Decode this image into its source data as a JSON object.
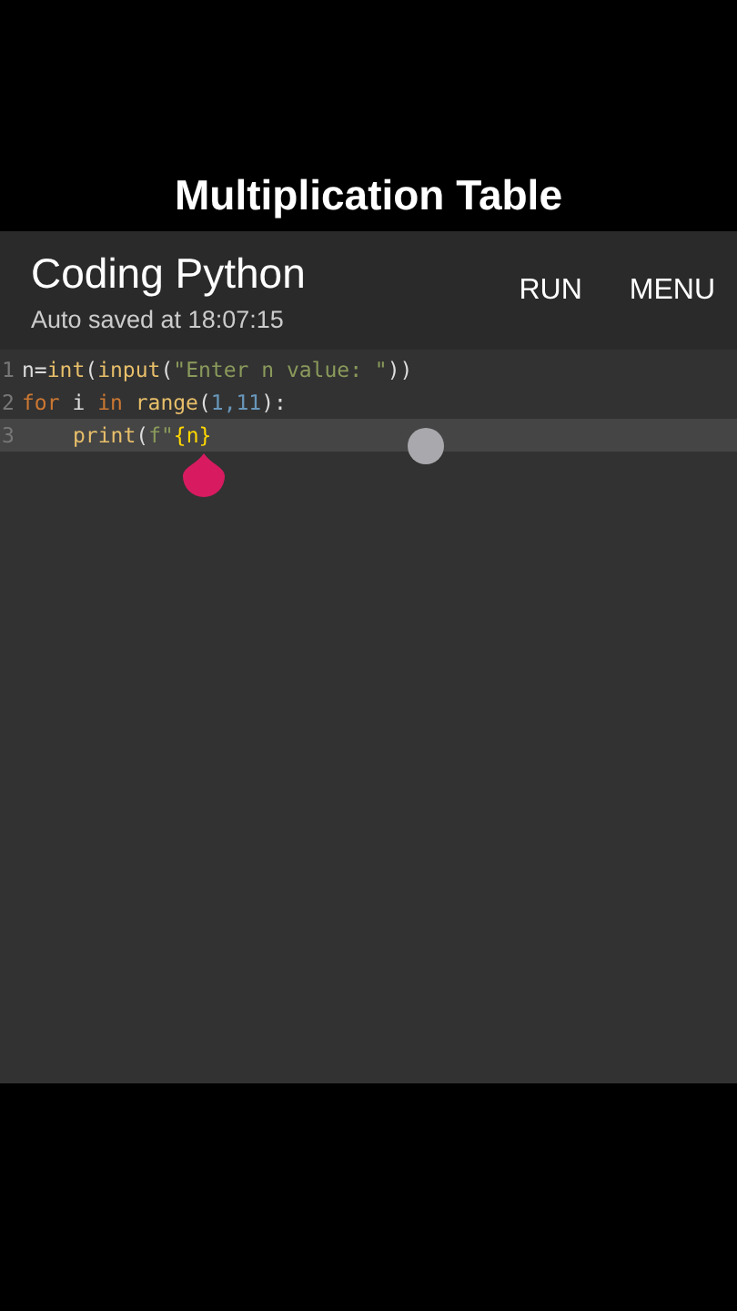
{
  "video_title": "Multiplication Table",
  "app_bar": {
    "title": "Coding Python",
    "subtitle": "Auto saved at 18:07:15",
    "actions": [
      "RUN",
      "MENU"
    ]
  },
  "editor": {
    "lines": [
      {
        "number": "1",
        "current": false,
        "tokens": [
          {
            "text": "n=",
            "kind": "plain"
          },
          {
            "text": "int",
            "kind": "builtin"
          },
          {
            "text": "(",
            "kind": "plain"
          },
          {
            "text": "input",
            "kind": "builtin"
          },
          {
            "text": "(",
            "kind": "plain"
          },
          {
            "text": "\"Enter n value: \"",
            "kind": "string"
          },
          {
            "text": "))",
            "kind": "plain"
          }
        ]
      },
      {
        "number": "2",
        "current": false,
        "tokens": [
          {
            "text": "for ",
            "kind": "keyword"
          },
          {
            "text": "i ",
            "kind": "plain"
          },
          {
            "text": "in ",
            "kind": "keyword"
          },
          {
            "text": "range",
            "kind": "builtin"
          },
          {
            "text": "(",
            "kind": "plain"
          },
          {
            "text": "1,11",
            "kind": "number"
          },
          {
            "text": "):",
            "kind": "plain"
          }
        ]
      },
      {
        "number": "3",
        "current": true,
        "indented": true,
        "tokens": [
          {
            "text": "print",
            "kind": "builtin"
          },
          {
            "text": "(",
            "kind": "plain"
          },
          {
            "text": "f\"",
            "kind": "string"
          },
          {
            "text": "{n}",
            "kind": "brace"
          }
        ]
      }
    ]
  }
}
